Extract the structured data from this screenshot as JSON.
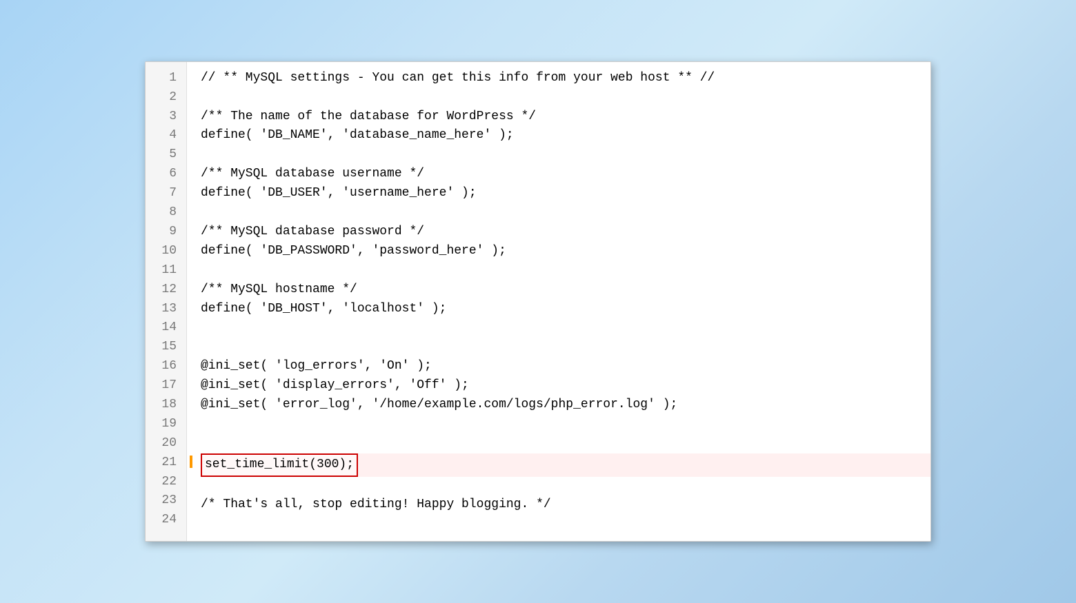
{
  "editor": {
    "lines": [
      {
        "num": 1,
        "content": "// ** MySQL settings - You can get this info from your web host ** //",
        "type": "comment",
        "highlighted": false
      },
      {
        "num": 2,
        "content": "",
        "type": "empty",
        "highlighted": false
      },
      {
        "num": 3,
        "content": "/** The name of the database for WordPress */",
        "type": "comment",
        "highlighted": false
      },
      {
        "num": 4,
        "content": "define( 'DB_NAME', 'database_name_here' );",
        "type": "code",
        "highlighted": false
      },
      {
        "num": 5,
        "content": "",
        "type": "empty",
        "highlighted": false
      },
      {
        "num": 6,
        "content": "/** MySQL database username */",
        "type": "comment",
        "highlighted": false
      },
      {
        "num": 7,
        "content": "define( 'DB_USER', 'username_here' );",
        "type": "code",
        "highlighted": false
      },
      {
        "num": 8,
        "content": "",
        "type": "empty",
        "highlighted": false
      },
      {
        "num": 9,
        "content": "/** MySQL database password */",
        "type": "comment",
        "highlighted": false
      },
      {
        "num": 10,
        "content": "define( 'DB_PASSWORD', 'password_here' );",
        "type": "code",
        "highlighted": false
      },
      {
        "num": 11,
        "content": "",
        "type": "empty",
        "highlighted": false
      },
      {
        "num": 12,
        "content": "/** MySQL hostname */",
        "type": "comment",
        "highlighted": false
      },
      {
        "num": 13,
        "content": "define( 'DB_HOST', 'localhost' );",
        "type": "code",
        "highlighted": false
      },
      {
        "num": 14,
        "content": "",
        "type": "empty",
        "highlighted": false
      },
      {
        "num": 15,
        "content": "",
        "type": "empty",
        "highlighted": false
      },
      {
        "num": 16,
        "content": "@ini_set( 'log_errors', 'On' );",
        "type": "code",
        "highlighted": false
      },
      {
        "num": 17,
        "content": "@ini_set( 'display_errors', 'Off' );",
        "type": "code",
        "highlighted": false
      },
      {
        "num": 18,
        "content": "@ini_set( 'error_log', '/home/example.com/logs/php_error.log' );",
        "type": "code",
        "highlighted": false
      },
      {
        "num": 19,
        "content": "",
        "type": "empty",
        "highlighted": false
      },
      {
        "num": 20,
        "content": "",
        "type": "empty",
        "highlighted": false
      },
      {
        "num": 21,
        "content": "set_time_limit(300);",
        "type": "code-highlighted",
        "highlighted": true
      },
      {
        "num": 22,
        "content": "",
        "type": "empty",
        "highlighted": false
      },
      {
        "num": 23,
        "content": "/* That's all, stop editing! Happy blogging. */",
        "type": "comment",
        "highlighted": false
      },
      {
        "num": 24,
        "content": "",
        "type": "empty",
        "highlighted": false
      }
    ]
  }
}
